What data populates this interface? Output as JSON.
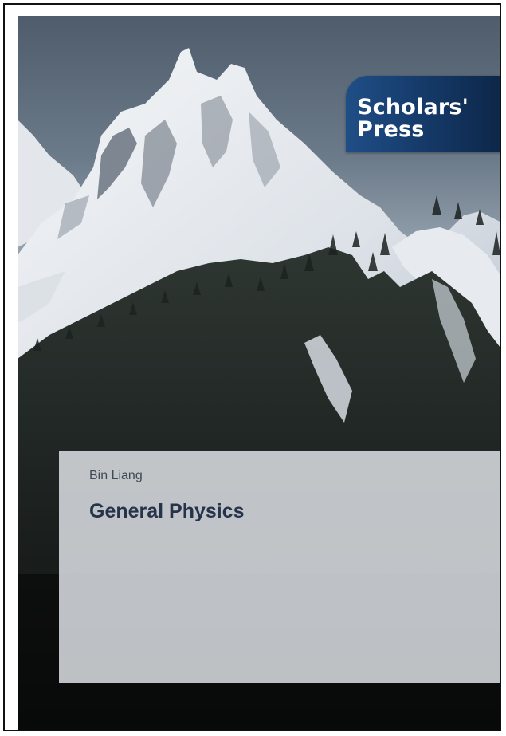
{
  "cover": {
    "publisher_line1": "Scholars'",
    "publisher_line2": "Press",
    "author": "Bin Liang",
    "title": "General Physics"
  },
  "colors": {
    "publisher_tab": "#163c6c",
    "title_text": "#26344a",
    "author_text": "#3f4a57",
    "panel": "#e2e6eb"
  }
}
